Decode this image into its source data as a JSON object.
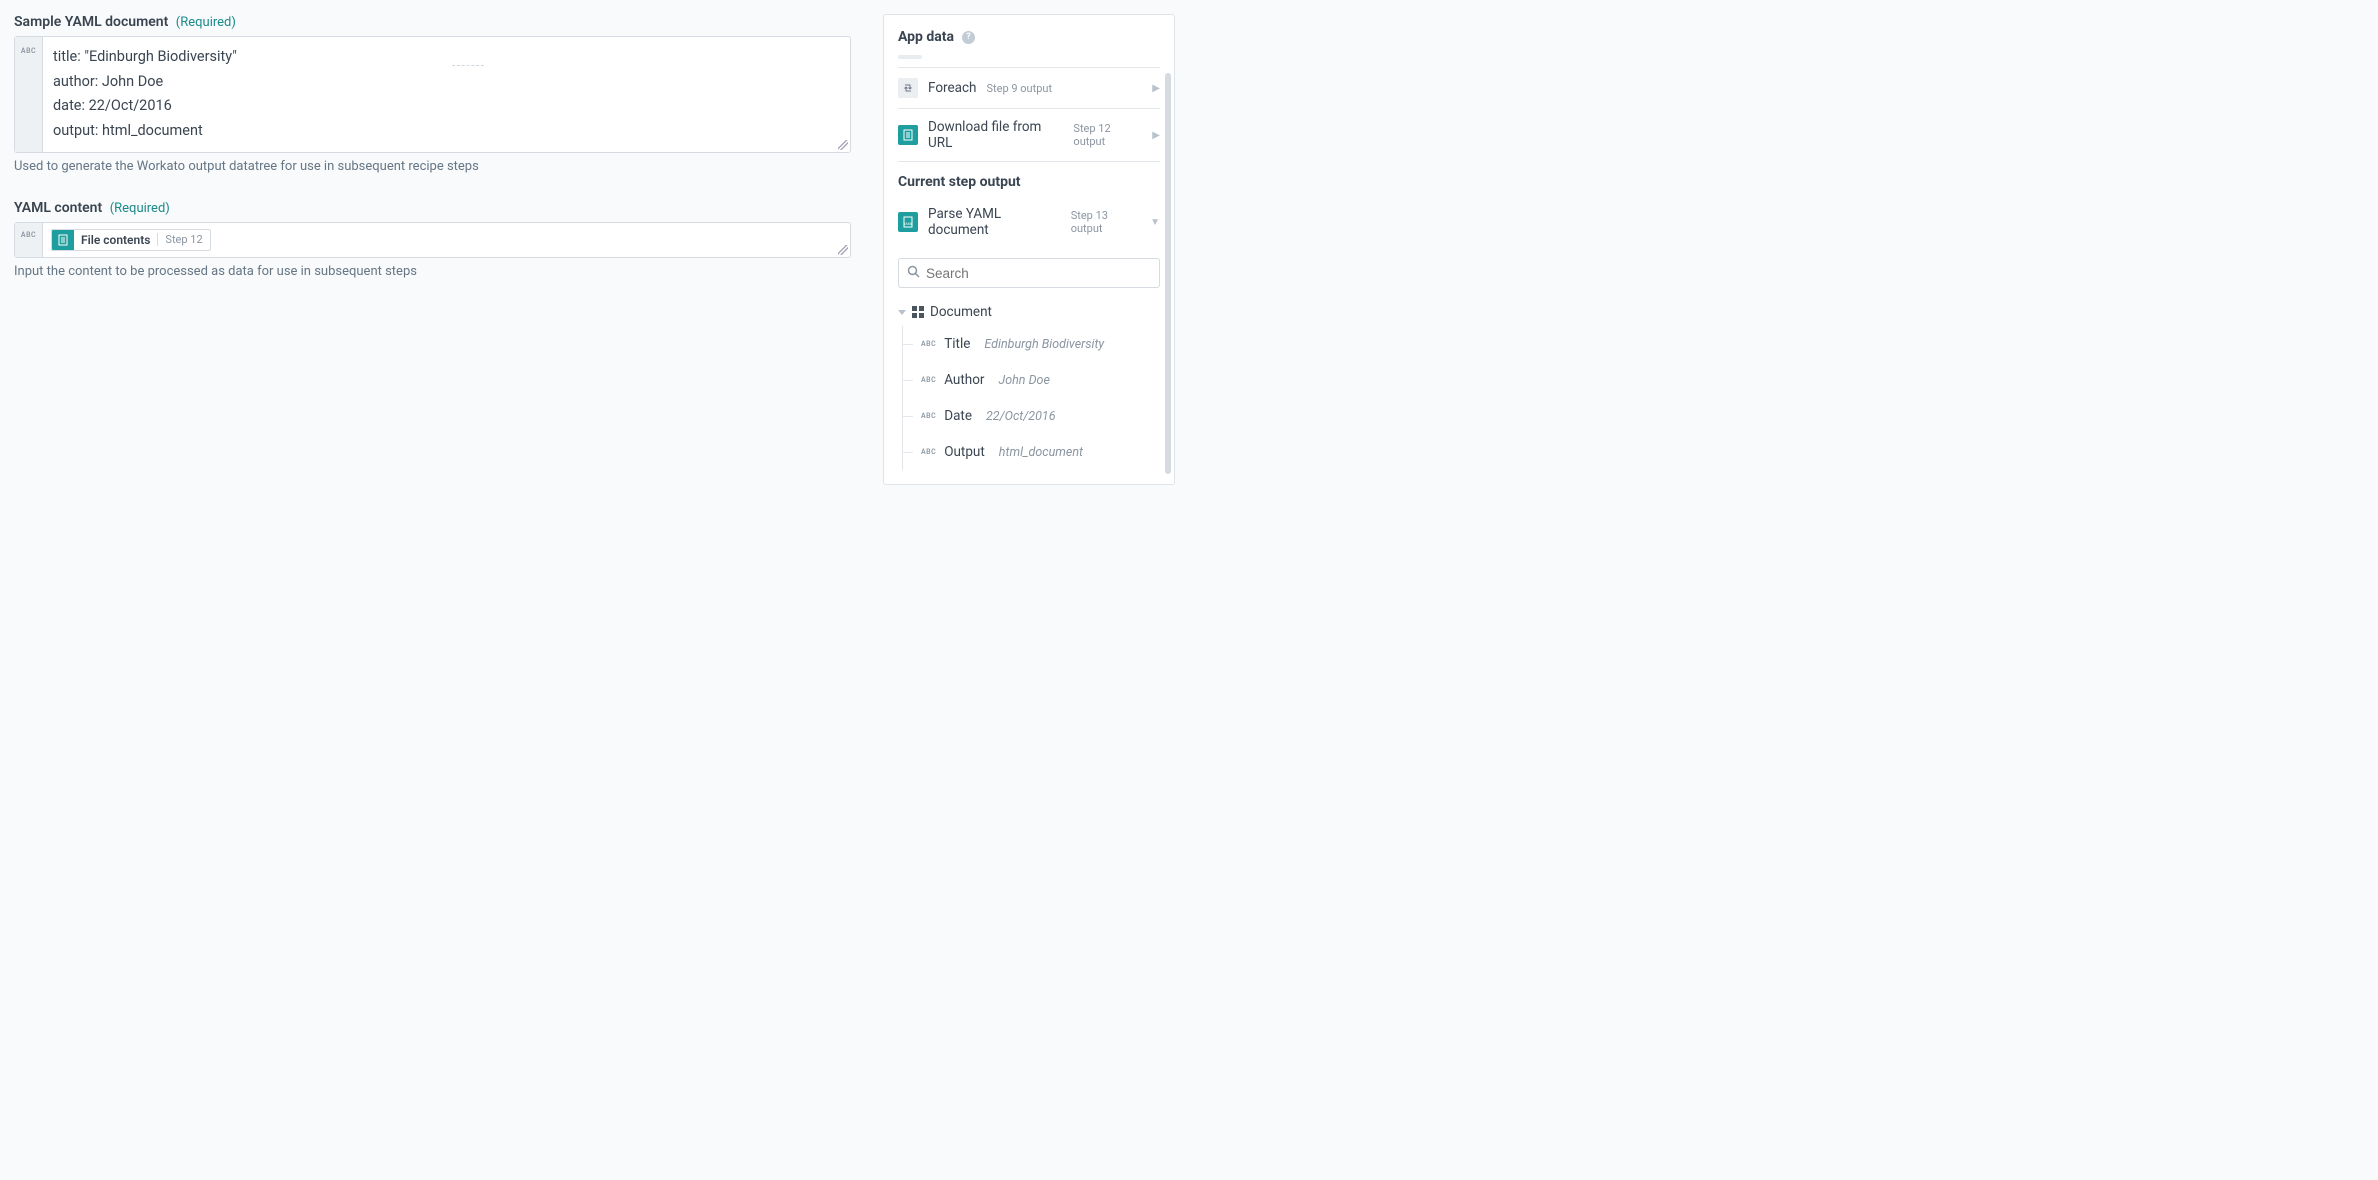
{
  "left": {
    "sample": {
      "label": "Sample YAML document",
      "required": "(Required)",
      "abc": "ABC",
      "content": "title: \"Edinburgh Biodiversity\"\nauthor: John Doe\ndate: 22/Oct/2016\noutput: html_document",
      "help": "Used to generate the Workato output datatree for use in subsequent recipe steps"
    },
    "yaml": {
      "label": "YAML content",
      "required": "(Required)",
      "abc": "ABC",
      "pill_label": "File contents",
      "pill_step": "Step 12",
      "help": "Input the content to be processed as data for use in subsequent steps"
    }
  },
  "right": {
    "header": "App data",
    "rows": [
      {
        "icon": "loop",
        "title": "Foreach",
        "step": "Step 9 output"
      },
      {
        "icon": "file",
        "title": "Download file from URL",
        "step": "Step 12 output"
      }
    ],
    "section": "Current step output",
    "current": {
      "icon": "yaml",
      "title": "Parse YAML document",
      "step": "Step 13 output"
    },
    "search_placeholder": "Search",
    "tree_root": "Document",
    "leaves": [
      {
        "name": "Title",
        "val": "Edinburgh Biodiversity"
      },
      {
        "name": "Author",
        "val": "John Doe"
      },
      {
        "name": "Date",
        "val": "22/Oct/2016"
      },
      {
        "name": "Output",
        "val": "html_document"
      }
    ],
    "abc": "ABC"
  },
  "icons": {
    "help": "?",
    "search": "🔍"
  }
}
